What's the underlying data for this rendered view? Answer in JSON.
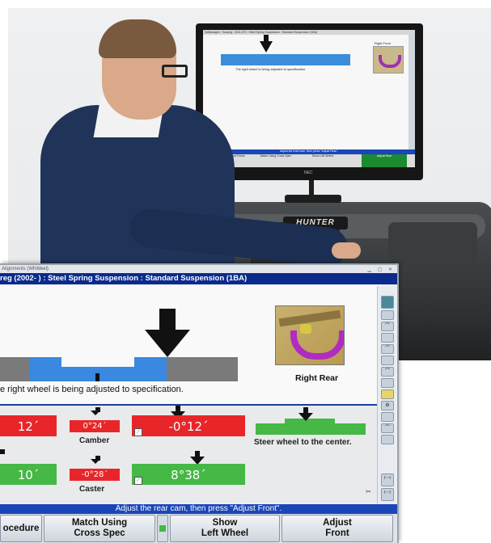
{
  "screen": {
    "window_title": "Alignments (WhWeel)",
    "header": "reg (2002- ) : Steel Spring Suspension : Standard Suspension (1BA)",
    "status_text": "e right wheel is being adjusted to specification.",
    "photo_label": "Right Rear",
    "readings": {
      "camber_left_value": "12´",
      "camber_spec_value": "0°24´",
      "camber_right_value": "-0°12´",
      "camber_label": "Camber",
      "caster_left_value": "10´",
      "caster_spec_value": "-0°28´",
      "caster_right_value": "8°38´",
      "caster_label": "Caster",
      "steer_label": "Steer wheel to the center."
    },
    "instruction": "Adjust the rear cam, then press \"Adjust Front\".",
    "buttons": {
      "procedure": "ocedure",
      "match_line1": "Match Using",
      "match_line2": "Cross Spec",
      "show_line1": "Show",
      "show_line2": "Left Wheel",
      "adjust_line1": "Adjust",
      "adjust_line2": "Front"
    }
  },
  "monitor": {
    "title": "Volkswagen : Touareg : 2011-270 : Steel Spring Suspension : Standard Suspension (1BA)",
    "caption": "The right wheel is being adjusted to specification.",
    "pic_label": "Right Front",
    "instruction": "Adjust the front cam, then press \"Adjust Rear\".",
    "btn_lower": "Lower Wheels and Finish",
    "btn_match": "Match Using Cross Spec",
    "btn_show": "Show Left Wheel",
    "btn_adjust": "Adjust Rear",
    "brand": "NEC"
  },
  "console_brand": "HUNTER",
  "colors": {
    "red": "#e8262a",
    "green": "#45b845",
    "blue": "#3a88e0",
    "title_blue": "#0a2a8c"
  }
}
